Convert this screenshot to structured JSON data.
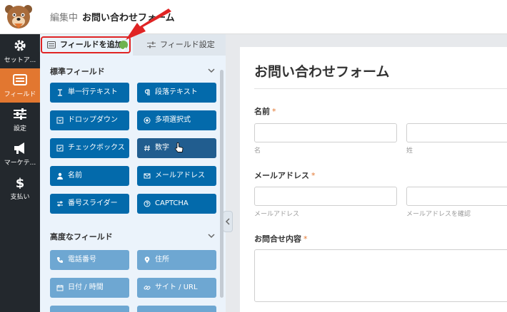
{
  "header": {
    "editing_label": "編集中",
    "form_name": "お問い合わせフォーム"
  },
  "sidebar": {
    "items": [
      {
        "label": "セットア...",
        "icon": "gear-icon"
      },
      {
        "label": "フィールド",
        "icon": "fields-icon",
        "active": true
      },
      {
        "label": "設定",
        "icon": "sliders-icon"
      },
      {
        "label": "マーケテ...",
        "icon": "megaphone-icon"
      },
      {
        "label": "支払い",
        "icon": "dollar-icon"
      }
    ]
  },
  "panel": {
    "tab_add": "フィールドを追加",
    "tab_settings": "フィールド設定",
    "standard_title": "標準フィールド",
    "standard_fields": [
      "単一行テキスト",
      "段落テキスト",
      "ドロップダウン",
      "多項選択式",
      "チェックボックス",
      "数字",
      "名前",
      "メールアドレス",
      "番号スライダー",
      "CAPTCHA"
    ],
    "advanced_title": "高度なフィールド",
    "advanced_fields": [
      "電話番号",
      "住所",
      "日付 / 時間",
      "サイト / URL"
    ]
  },
  "preview": {
    "title": "お問い合わせフォーム",
    "name_label": "名前",
    "first_sub": "名",
    "last_sub": "姓",
    "email_label": "メールアドレス",
    "email_sub": "メールアドレス",
    "email_confirm_sub": "メールアドレスを確認",
    "message_label": "お問合せ内容",
    "required_mark": "*"
  },
  "colors": {
    "accent_orange": "#e27730",
    "button_blue": "#036aab",
    "button_hover": "#215d8f",
    "advanced_blue": "#6ea7d2",
    "sidebar_dark": "#23282d",
    "highlight_red": "#e02424"
  }
}
